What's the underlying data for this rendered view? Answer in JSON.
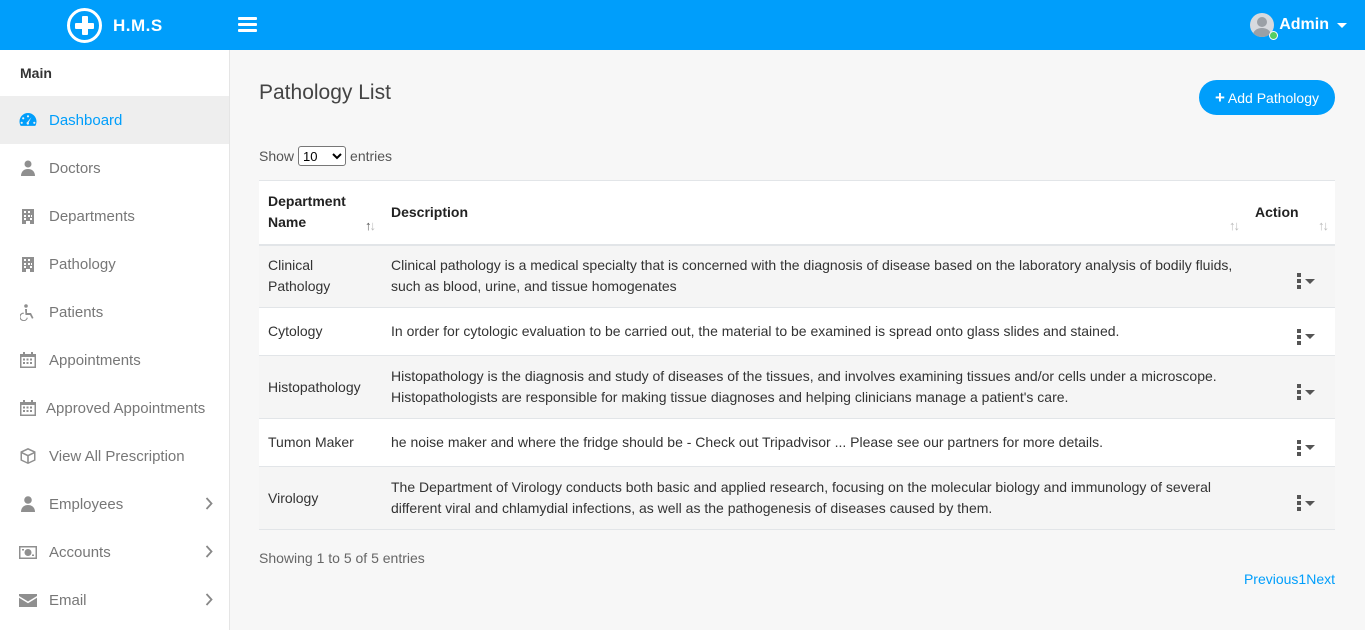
{
  "header": {
    "logo_text": "H.M.S",
    "user_name": "Admin"
  },
  "sidebar": {
    "title": "Main",
    "items": [
      {
        "label": "Dashboard",
        "icon": "dashboard-icon"
      },
      {
        "label": "Doctors",
        "icon": "user-md-icon"
      },
      {
        "label": "Departments",
        "icon": "hospital-icon"
      },
      {
        "label": "Pathology",
        "icon": "hospital-icon"
      },
      {
        "label": "Patients",
        "icon": "wheelchair-icon"
      },
      {
        "label": "Appointments",
        "icon": "calendar-icon"
      },
      {
        "label": "Approved Appointments",
        "icon": "calendar-icon"
      },
      {
        "label": "View All Prescription",
        "icon": "cube-icon"
      },
      {
        "label": "Employees",
        "icon": "user-icon"
      },
      {
        "label": "Accounts",
        "icon": "money-icon"
      },
      {
        "label": "Email",
        "icon": "envelope-icon"
      }
    ]
  },
  "main": {
    "page_title": "Pathology List",
    "add_button_label": "Add Pathology",
    "show_label": "Show",
    "entries_label": "entries",
    "page_size": "10",
    "columns": [
      "Department Name",
      "Description",
      "Action"
    ],
    "rows": [
      {
        "name": "Clinical Pathology",
        "description": "Clinical pathology is a medical specialty that is concerned with the diagnosis of disease based on the laboratory analysis of bodily fluids, such as blood, urine, and tissue homogenates"
      },
      {
        "name": "Cytology",
        "description": "In order for cytologic evaluation to be carried out, the material to be examined is spread onto glass slides and stained."
      },
      {
        "name": "Histopathology",
        "description": "Histopathology is the diagnosis and study of diseases of the tissues, and involves examining tissues and/or cells under a microscope. Histopathologists are responsible for making tissue diagnoses and helping clinicians manage a patient's care."
      },
      {
        "name": "Tumon Maker",
        "description": "he noise maker and where the fridge should be - Check out Tripadvisor ... Please see our partners for more details."
      },
      {
        "name": "Virology",
        "description": "The Department of Virology conducts both basic and applied research, focusing on the molecular biology and immunology of several different viral and chlamydial infections, as well as the pathogenesis of diseases caused by them."
      }
    ],
    "info_text": "Showing 1 to 5 of 5 entries",
    "pager": {
      "previous": "Previous",
      "current": "1",
      "next": "Next"
    }
  },
  "colors": {
    "primary": "#009efb",
    "online": "#55ce63"
  }
}
